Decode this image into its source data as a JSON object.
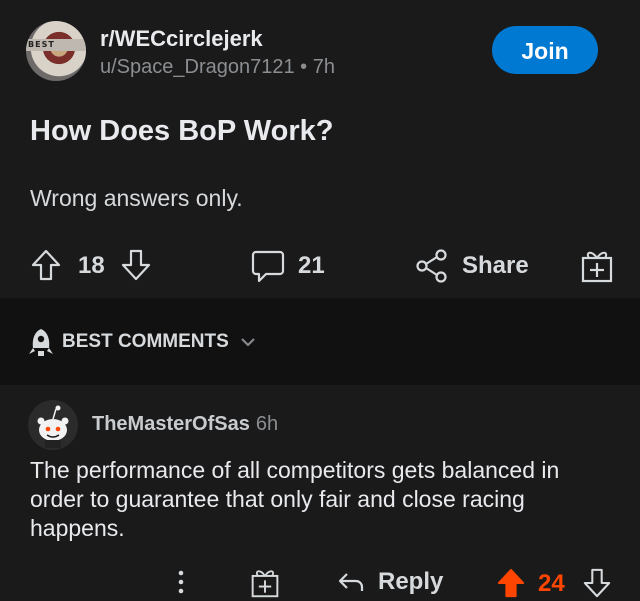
{
  "post": {
    "subreddit": "r/WECcirclejerk",
    "author_line": "u/Space_Dragon7121 • 7h",
    "join_label": "Join",
    "avatar_text": "BEST",
    "title": "How Does BoP Work?",
    "body": "Wrong answers only.",
    "upvotes": "18",
    "comments": "21",
    "share_label": "Share"
  },
  "sort": {
    "label": "BEST COMMENTS"
  },
  "comment": {
    "username": "TheMasterOfSas",
    "time": "6h",
    "text": "The performance of all competitors gets balanced in order to guarantee that only fair and close racing happens.",
    "reply_label": "Reply",
    "votes": "24"
  },
  "colors": {
    "background": "#1a1a1b",
    "divider": "#111112",
    "join": "#0079d3",
    "upvote_active": "#ff4500"
  },
  "icons": [
    "upvote-icon",
    "downvote-icon",
    "comment-icon",
    "share-icon",
    "award-icon",
    "sort-rocket-icon",
    "chevron-down-icon",
    "more-icon",
    "reply-icon"
  ]
}
